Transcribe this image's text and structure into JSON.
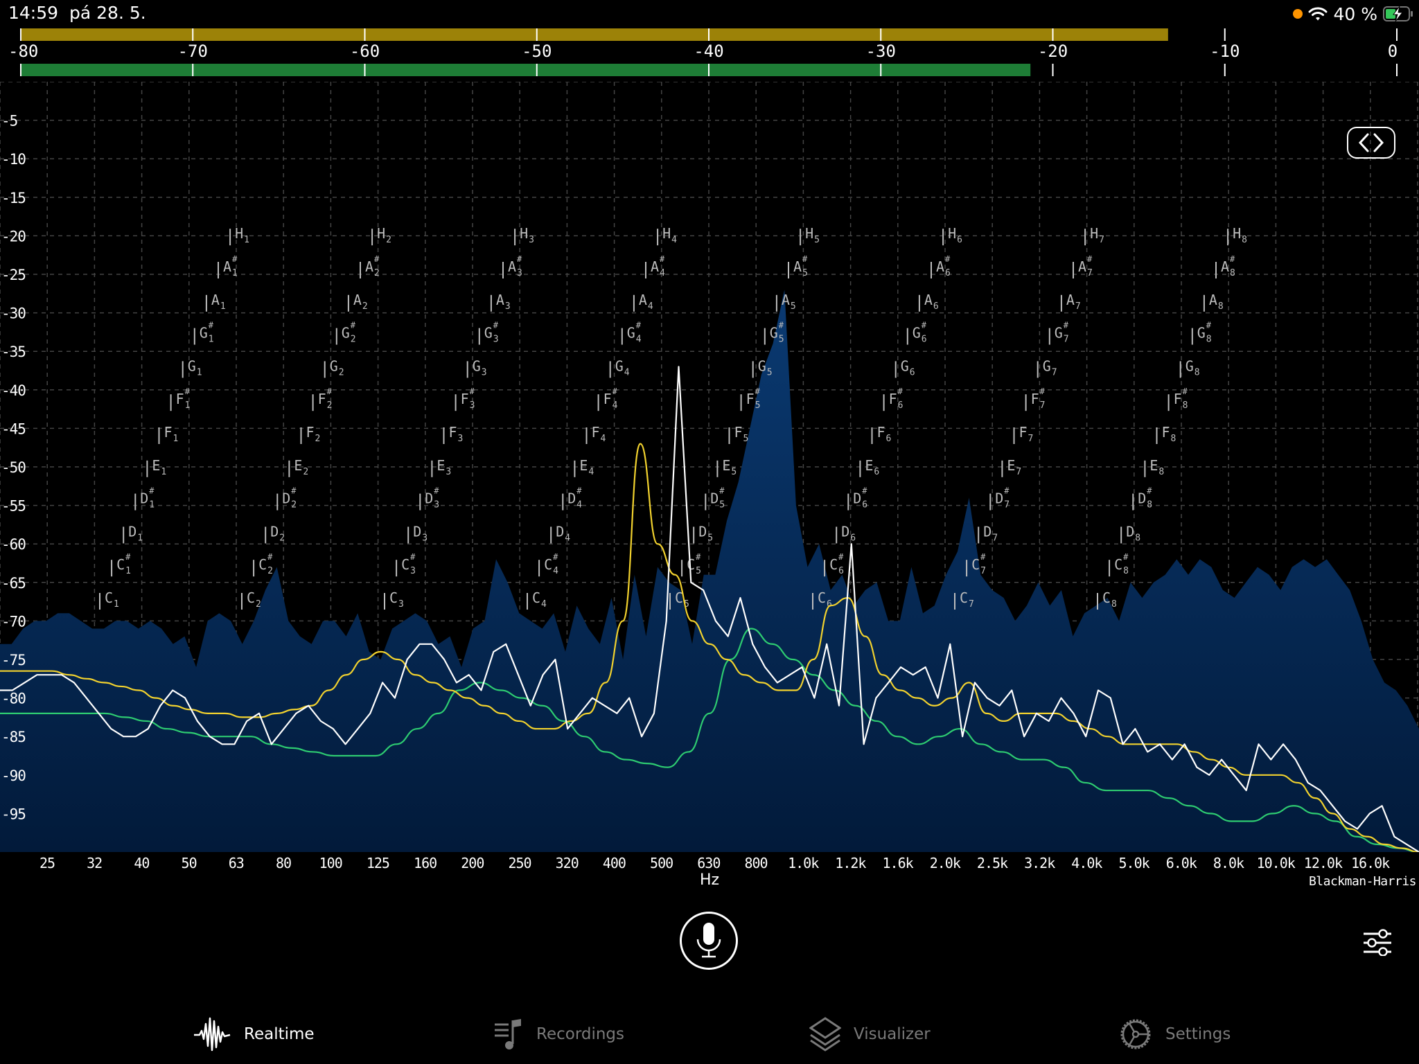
{
  "status_bar": {
    "time": "14:59",
    "date": "pá 28. 5.",
    "battery_percent": "40 %",
    "battery_level": 0.4,
    "charging": true,
    "recording_dot_color": "#ff9500"
  },
  "level_meter": {
    "scale_labels": [
      "-80",
      "-70",
      "-60",
      "-50",
      "-40",
      "-30",
      "-20",
      "-10",
      "0"
    ],
    "scale_values": [
      -80,
      -70,
      -60,
      -50,
      -40,
      -30,
      -20,
      -10,
      0
    ],
    "peak_level_db": -13.3,
    "rms_level_db": -21.3,
    "peak_color": "#9c8208",
    "rms_color": "#1e7d36"
  },
  "spectrum": {
    "y_labels": [
      "-5",
      "-10",
      "-15",
      "-20",
      "-25",
      "-30",
      "-35",
      "-40",
      "-45",
      "-50",
      "-55",
      "-60",
      "-65",
      "-70",
      "-75",
      "-80",
      "-85",
      "-90",
      "-95"
    ],
    "y_values": [
      -5,
      -10,
      -15,
      -20,
      -25,
      -30,
      -35,
      -40,
      -45,
      -50,
      -55,
      -60,
      -65,
      -70,
      -75,
      -80,
      -85,
      -90,
      -95
    ],
    "y_range": [
      0,
      -100
    ],
    "x_labels": [
      "25",
      "32",
      "40",
      "50",
      "63",
      "80",
      "100",
      "125",
      "160",
      "200",
      "250",
      "320",
      "400",
      "500",
      "630",
      "800",
      "1.0k",
      "1.2k",
      "1.6k",
      "2.0k",
      "2.5k",
      "3.2k",
      "4.0k",
      "5.0k",
      "6.0k",
      "8.0k",
      "10.0k",
      "12.0k",
      "16.0k"
    ],
    "x_unit": "Hz",
    "window_function": "Blackman-Harris",
    "note_names": [
      "C",
      "C#",
      "D",
      "D#",
      "E",
      "F",
      "F#",
      "G",
      "G#",
      "A",
      "A#",
      "H"
    ],
    "octaves": [
      1,
      2,
      3,
      4,
      5,
      6,
      7,
      8
    ],
    "colors": {
      "fill_top": "#0a3a72",
      "fill_bottom": "#021a3a",
      "white_line": "#ffffff",
      "yellow_line": "#f2d22e",
      "green_line": "#2ecc71",
      "note_label": "#bdbdbd"
    },
    "peak_hold_db": [
      -73,
      -73,
      -71,
      -70,
      -70,
      -69,
      -69,
      -70,
      -71,
      -71,
      -70,
      -70,
      -71,
      -70,
      -71,
      -73,
      -72,
      -76,
      -70,
      -69,
      -70,
      -73,
      -70,
      -66,
      -63,
      -70,
      -72,
      -73,
      -70,
      -70,
      -72,
      -69,
      -74,
      -75,
      -71,
      -70,
      -69,
      -70,
      -73,
      -72,
      -76,
      -71,
      -70,
      -62,
      -65,
      -69,
      -70,
      -71,
      -69,
      -74,
      -68,
      -71,
      -73,
      -67,
      -75,
      -64,
      -72,
      -63,
      -65,
      -66,
      -73,
      -64,
      -64,
      -57,
      -52,
      -45,
      -38,
      -34,
      -27,
      -55,
      -63,
      -60,
      -66,
      -64,
      -68,
      -66,
      -65,
      -70,
      -70,
      -63,
      -69,
      -68,
      -64,
      -61,
      -54,
      -64,
      -66,
      -67,
      -70,
      -68,
      -65,
      -68,
      -66,
      -72,
      -69,
      -68,
      -67,
      -70,
      -65,
      -67,
      -65,
      -64,
      -62,
      -64,
      -62,
      -63,
      -66,
      -67,
      -65,
      -63,
      -64,
      -66,
      -63,
      -62,
      -63,
      -62,
      -64,
      -66,
      -70,
      -75,
      -78,
      -79,
      -81,
      -84
    ],
    "white_db": [
      -79,
      -79,
      -78,
      -77,
      -77,
      -77,
      -78,
      -80,
      -82,
      -84,
      -85,
      -85,
      -84,
      -81,
      -79,
      -80,
      -83,
      -85,
      -86,
      -86,
      -83,
      -82,
      -86,
      -84,
      -82,
      -81,
      -83,
      -84,
      -86,
      -84,
      -82,
      -78,
      -80,
      -75,
      -73,
      -73,
      -75,
      -78,
      -77,
      -79,
      -74,
      -73,
      -77,
      -81,
      -77,
      -75,
      -84,
      -82,
      -80,
      -81,
      -82,
      -80,
      -85,
      -82,
      -70,
      -37,
      -65,
      -66,
      -70,
      -72,
      -67,
      -73,
      -76,
      -78,
      -77,
      -76,
      -80,
      -73,
      -81,
      -60,
      -86,
      -80,
      -78,
      -76,
      -77,
      -76,
      -80,
      -73,
      -85,
      -78,
      -80,
      -81,
      -79,
      -85,
      -82,
      -83,
      -80,
      -82,
      -85,
      -79,
      -80,
      -86,
      -84,
      -87,
      -86,
      -88,
      -86,
      -89,
      -90,
      -88,
      -90,
      -92,
      -86,
      -88,
      -86,
      -88,
      -91,
      -92,
      -94,
      -96,
      -97,
      -95,
      -94,
      -98,
      -99,
      -100
    ],
    "yellow_db": [
      -76.5,
      -76.5,
      -76.5,
      -76.5,
      -77,
      -77.5,
      -78,
      -78.5,
      -79,
      -80,
      -81,
      -81.5,
      -82,
      -82,
      -82.5,
      -82.5,
      -82,
      -81.5,
      -81,
      -79,
      -77,
      -75,
      -74,
      -75,
      -77,
      -78,
      -79,
      -80,
      -81,
      -82,
      -83,
      -84,
      -84,
      -83,
      -82,
      -78,
      -70,
      -47,
      -60,
      -64,
      -70,
      -73,
      -75,
      -77,
      -78,
      -79,
      -79,
      -75,
      -68,
      -67,
      -72,
      -77,
      -79,
      -80,
      -81,
      -80,
      -78,
      -82,
      -83,
      -82,
      -82,
      -82,
      -83,
      -84,
      -85,
      -86,
      -86,
      -86,
      -86,
      -87,
      -88,
      -89,
      -90,
      -90,
      -90,
      -91,
      -93,
      -95,
      -97,
      -98,
      -99,
      -99.5,
      -100
    ],
    "green_db": [
      -82,
      -82,
      -82,
      -82,
      -82,
      -82,
      -82.5,
      -83,
      -84,
      -84.5,
      -85,
      -85,
      -85,
      -86,
      -86.5,
      -87,
      -87.5,
      -87.5,
      -87.5,
      -86,
      -84,
      -82,
      -79,
      -78,
      -79,
      -80,
      -81,
      -83,
      -85,
      -87,
      -88,
      -88.5,
      -89,
      -87,
      -82,
      -75,
      -71,
      -73,
      -75,
      -77,
      -79,
      -81,
      -83,
      -85,
      -86,
      -85,
      -84,
      -86,
      -87,
      -88,
      -88,
      -89,
      -91,
      -92,
      -92,
      -92,
      -93,
      -94,
      -95,
      -96,
      -96,
      -95,
      -94,
      -95,
      -96,
      -98,
      -99,
      -99.5,
      -100
    ]
  },
  "controls": {
    "toggle_icon": "code-brackets-icon",
    "mic_icon": "microphone-icon",
    "sliders_icon": "sliders-icon"
  },
  "tabbar": {
    "tabs": [
      {
        "label": "Realtime",
        "icon": "waveform-icon",
        "active": true
      },
      {
        "label": "Recordings",
        "icon": "music-list-icon",
        "active": false
      },
      {
        "label": "Visualizer",
        "icon": "layers-icon",
        "active": false
      },
      {
        "label": "Settings",
        "icon": "gear-icon",
        "active": false
      }
    ]
  }
}
